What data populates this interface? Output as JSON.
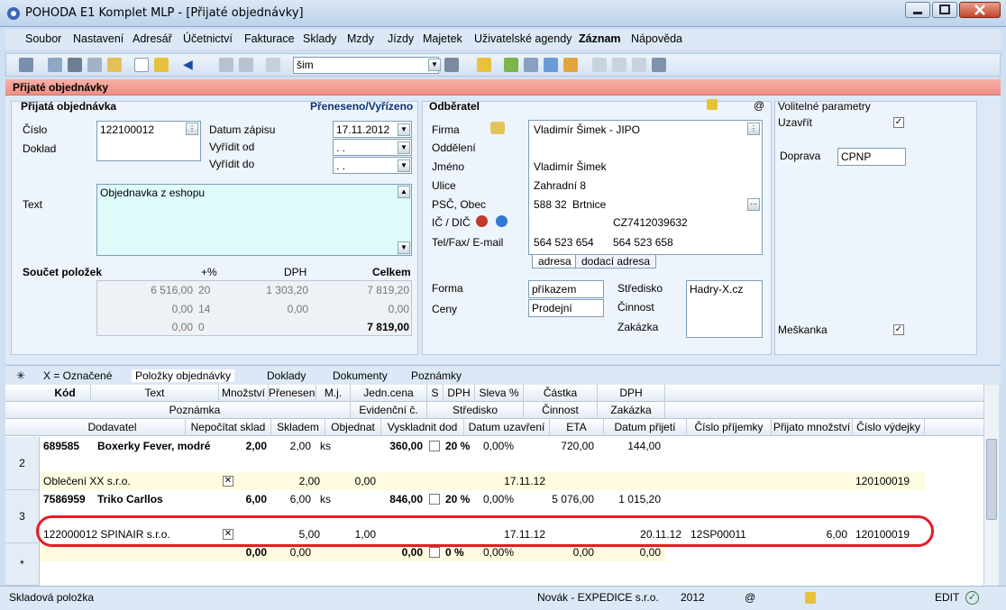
{
  "window": {
    "title": "POHODA E1 Komplet MLP - [Přijaté objednávky]"
  },
  "menu": [
    "Soubor",
    "Nastavení",
    "Adresář",
    "Účetnictví",
    "Fakturace",
    "Sklady",
    "Mzdy",
    "Jízdy",
    "Majetek",
    "Uživatelské agendy",
    "Záznam",
    "Nápověda"
  ],
  "toolbar": {
    "search_value": "šim"
  },
  "agenda": {
    "title": "Přijaté objednávky"
  },
  "order": {
    "section": "Přijatá objednávka",
    "status": "Přeneseno/Vyřízeno",
    "cislo_label": "Číslo",
    "cislo": "122100012",
    "doklad_label": "Doklad",
    "datum_zapisu_label": "Datum zápisu",
    "datum_zapisu": "17.11.2012",
    "vyridit_od_label": "Vyřídit od",
    "vyridit_od": " .  . ",
    "vyridit_do_label": "Vyřídit do",
    "vyridit_do": " .  . ",
    "text_label": "Text",
    "text": "Objednavka z eshopu"
  },
  "sum": {
    "label": "Součet položek",
    "h_pct": "+%",
    "h_dph": "DPH",
    "h_celkem": "Celkem",
    "rows": [
      {
        "base": "6 516,00",
        "pct": "20",
        "dph": "1 303,20",
        "total": "7 819,20"
      },
      {
        "base": "0,00",
        "pct": "14",
        "dph": "0,00",
        "total": "0,00"
      },
      {
        "base": "0,00",
        "pct": "0",
        "dph": "",
        "total": "7 819,00"
      }
    ]
  },
  "customer": {
    "section": "Odběratel",
    "at": "@",
    "firma_label": "Firma",
    "firma": "Vladimír Šimek - JIPO",
    "oddeleni_label": "Oddělení",
    "jmeno_label": "Jméno",
    "jmeno": "Vladimír Šimek",
    "ulice_label": "Ulice",
    "ulice": "Zahradní 8",
    "psc_label": "PSČ, Obec",
    "psc": "588 32",
    "obec": "Brtnice",
    "ic_label": "IČ / DIČ",
    "dic": "CZ7412039632",
    "tel_label": "Tel/Fax/ E-mail",
    "tel": "564 523 654",
    "fax": "564 523 658",
    "tab_adresa": "adresa",
    "tab_dodaci": "dodací adresa",
    "forma_label": "Forma",
    "forma": "příkazem",
    "ceny_label": "Ceny",
    "ceny": "Prodejní",
    "stredisko_label": "Středisko",
    "stredisko": "Hadry-X.cz",
    "cinnost_label": "Činnost",
    "zakazka_label": "Zakázka"
  },
  "params": {
    "title": "Volitelné parametry",
    "uzavrit": "Uzavřít",
    "doprava_label": "Doprava",
    "doprava": "CPNP",
    "meskanka": "Meškanka"
  },
  "tabs": [
    "X = Označené",
    "Položky objednávky",
    "Doklady",
    "Dokumenty",
    "Poznámky"
  ],
  "grid": {
    "h1": [
      "Kód",
      "Text",
      "Množství",
      "Přeneseno",
      "M.j.",
      "Jedn.cena",
      "S",
      "DPH",
      "Sleva %",
      "Částka",
      "DPH"
    ],
    "h2": [
      "Poznámka",
      "Evidenční č.",
      "Středisko",
      "Činnost",
      "Zakázka"
    ],
    "h3": [
      "Dodavatel",
      "Nepočítat sklad",
      "Skladem",
      "Objednat",
      "Vyskladnit dod",
      "Datum uzavření",
      "ETA",
      "Datum přijetí",
      "Číslo příjemky",
      "Přijato množství",
      "Číslo výdejky"
    ],
    "rows": [
      {
        "num": "2",
        "kod": "689585",
        "text": "Boxerky Fever, modré",
        "mnozstvi": "2,00",
        "preneseno": "2,00",
        "mj": "ks",
        "cena": "360,00",
        "dph": "20 %",
        "sleva": "0,00%",
        "castka": "720,00",
        "dph_amt": "144,00",
        "dodavatel": "Oblečení XX s.r.o.",
        "skladem": "2,00",
        "objednat": "0,00",
        "uzavreni": "17.11.12",
        "prijeti": "",
        "prijemka": "",
        "prijato": "",
        "vydejka": "120100019"
      },
      {
        "num": "3",
        "kod": "7586959",
        "text": "Triko Carllos",
        "mnozstvi": "6,00",
        "preneseno": "6,00",
        "mj": "ks",
        "cena": "846,00",
        "dph": "20 %",
        "sleva": "0,00%",
        "castka": "5 076,00",
        "dph_amt": "1 015,20",
        "dodavatel": "122000012 SPINAIR s.r.o.",
        "skladem": "5,00",
        "objednat": "1,00",
        "uzavreni": "17.11.12",
        "prijeti": "20.11.12",
        "prijemka": "12SP00011",
        "prijato": "6,00",
        "vydejka": "120100019"
      }
    ],
    "new_row": {
      "num": "*",
      "mnozstvi": "0,00",
      "preneseno": "0,00",
      "cena": "0,00",
      "dph": "0 %",
      "sleva": "0,00%",
      "castka": "0,00",
      "dph_amt": "0,00"
    }
  },
  "status": {
    "left": "Skladová položka",
    "user": "Novák - EXPEDICE s.r.o.",
    "year": "2012",
    "at": "@",
    "mode": "EDIT"
  }
}
